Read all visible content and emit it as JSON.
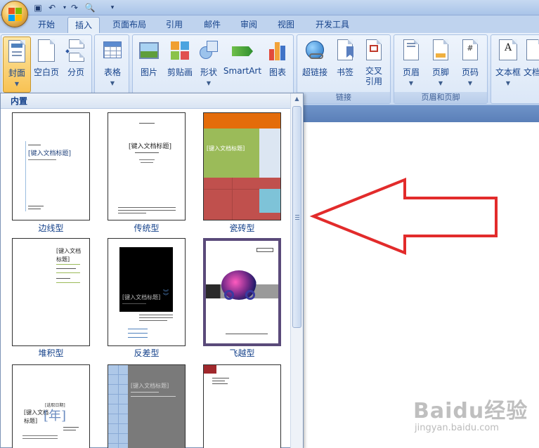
{
  "tabs": [
    "开始",
    "插入",
    "页面布局",
    "引用",
    "邮件",
    "审阅",
    "视图",
    "开发工具"
  ],
  "active_tab": "插入",
  "ribbon": {
    "pages_buttons": [
      "封面",
      "空白页",
      "分页"
    ],
    "table_button": "表格",
    "illustration_buttons": [
      "图片",
      "剪贴画",
      "形状",
      "SmartArt",
      "图表"
    ],
    "links_buttons": [
      "超链接",
      "书签",
      "交叉\n引用"
    ],
    "links_group": "链接",
    "header_footer_buttons": [
      "页眉",
      "页脚",
      "页码"
    ],
    "header_footer_group": "页眉和页脚",
    "text_buttons": [
      "文本框",
      "文档"
    ]
  },
  "gallery": {
    "header": "内置",
    "items": [
      {
        "label": "边线型"
      },
      {
        "label": "传统型"
      },
      {
        "label": "瓷砖型"
      },
      {
        "label": "堆积型"
      },
      {
        "label": "反差型"
      },
      {
        "label": "飞越型"
      }
    ],
    "thumb_text": {
      "title_generic": "[键入文档标题]",
      "title_split_a": "[键入文档",
      "title_split_b": "标题]",
      "year": "[年]",
      "year_small": "[选取日期]"
    }
  },
  "colors": {
    "accent_orange": "#e46c0a",
    "accent_green": "#9bbb59",
    "accent_red": "#c0504d",
    "accent_cyan": "#7ec3d8",
    "arrow_red": "#e22b2b"
  },
  "watermark": {
    "brand": "Baidu经验",
    "url": "jingyan.baidu.com"
  }
}
